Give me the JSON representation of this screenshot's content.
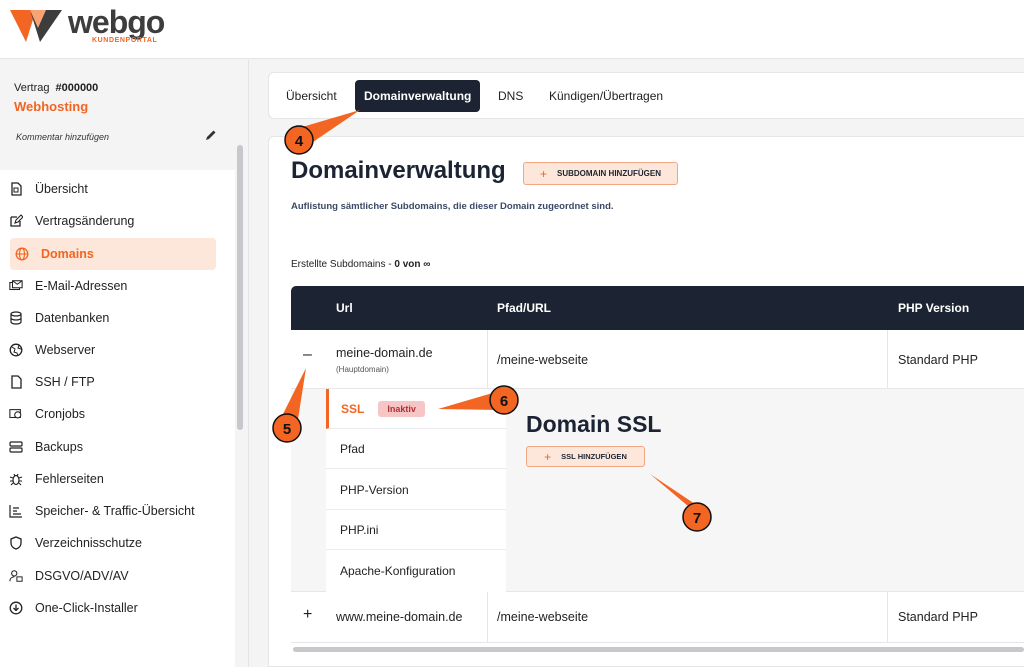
{
  "brand": {
    "name": "webgo",
    "tagline": "KUNDENPORTAL",
    "accent": "#f26522",
    "dark": "#1c2433"
  },
  "contract": {
    "label": "Vertrag",
    "number": "#000000",
    "type": "Webhosting",
    "comment": "Kommentar hinzufügen",
    "edit_icon": "pencil-icon"
  },
  "sidebar": {
    "items": [
      {
        "label": "Übersicht",
        "icon": "document-icon"
      },
      {
        "label": "Vertragsänderung",
        "icon": "edit-icon"
      },
      {
        "label": "Domains",
        "icon": "globe-icon",
        "active": true
      },
      {
        "label": "E-Mail-Adressen",
        "icon": "mail-icon"
      },
      {
        "label": "Datenbanken",
        "icon": "database-icon"
      },
      {
        "label": "Webserver",
        "icon": "globe-network-icon"
      },
      {
        "label": "SSH / FTP",
        "icon": "file-icon"
      },
      {
        "label": "Cronjobs",
        "icon": "clock-stack-icon"
      },
      {
        "label": "Backups",
        "icon": "server-icon"
      },
      {
        "label": "Fehlerseiten",
        "icon": "bug-icon"
      },
      {
        "label": "Speicher- & Traffic-Übersicht",
        "icon": "bar-chart-icon"
      },
      {
        "label": "Verzeichnisschutze",
        "icon": "shield-icon"
      },
      {
        "label": "DSGVO/ADV/AV",
        "icon": "user-lock-icon"
      },
      {
        "label": "One-Click-Installer",
        "icon": "download-circle-icon"
      }
    ]
  },
  "tabs": [
    {
      "label": "Übersicht"
    },
    {
      "label": "Domainverwaltung",
      "active": true
    },
    {
      "label": "DNS"
    },
    {
      "label": "Kündigen/Übertragen"
    }
  ],
  "main": {
    "title": "Domainverwaltung",
    "add_subdomain_label": "SUBDOMAIN HINZUFÜGEN",
    "description": "Auflistung sämtlicher Subdomains, die dieser Domain zugeordnet sind.",
    "count_prefix": "Erstellte Subdomains - ",
    "count_value": "0 von ∞"
  },
  "table": {
    "columns": [
      "Url",
      "Pfad/URL",
      "PHP Version"
    ],
    "rows": [
      {
        "url": "meine-domain.de",
        "note": "(Hauptdomain)",
        "path": "/meine-webseite",
        "php": "Standard PHP",
        "toggle": "–"
      },
      {
        "url": "www.meine-domain.de",
        "path": "/meine-webseite",
        "php": "Standard PHP",
        "toggle": "+"
      }
    ]
  },
  "detail": {
    "subnav": [
      {
        "label": "SSL",
        "badge": "Inaktiv",
        "active": true
      },
      {
        "label": "Pfad"
      },
      {
        "label": "PHP-Version"
      },
      {
        "label": "PHP.ini"
      },
      {
        "label": "Apache-Konfiguration"
      }
    ],
    "title": "Domain SSL",
    "add_ssl_label": "SSL HINZUFÜGEN"
  },
  "callouts": [
    "4",
    "5",
    "6",
    "7"
  ]
}
